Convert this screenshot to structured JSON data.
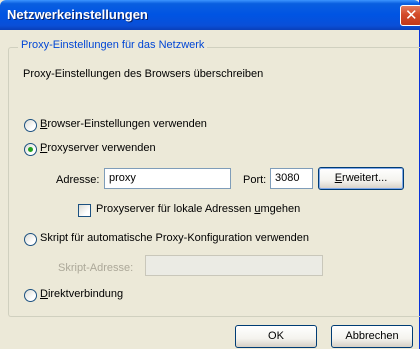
{
  "window": {
    "title": "Netzwerkeinstellungen"
  },
  "group": {
    "legend": "Proxy-Einstellungen für das Netzwerk",
    "override_label": "Proxy-Einstellungen des Browsers überschreiben"
  },
  "options": {
    "browser": {
      "label_rest": "rowser-Einstellungen verwenden",
      "mnemonic": "B",
      "selected": false
    },
    "proxy": {
      "label_rest": "roxyserver verwenden",
      "mnemonic": "P",
      "selected": true
    },
    "script": {
      "label": "Skript für automatische Proxy-Konfiguration verwenden",
      "selected": false
    },
    "direct": {
      "label_rest": "irektverbindung",
      "mnemonic": "D",
      "selected": false
    }
  },
  "proxy_fields": {
    "address_label": "Adresse:",
    "address_value": "proxy",
    "port_label": "Port:",
    "port_value": "3080",
    "advanced_mnemonic": "E",
    "advanced_rest": "rweitert...",
    "bypass_label_pre": "Proxyserver für lokale Adressen ",
    "bypass_mnemonic": "u",
    "bypass_label_post": "mgehen",
    "bypass_checked": false
  },
  "script_fields": {
    "address_label": "Skript-Adresse:",
    "address_value": ""
  },
  "buttons": {
    "ok": "OK",
    "cancel": "Abbrechen"
  },
  "colors": {
    "titlebar": "#0054e3",
    "dialog_bg": "#ece9d8",
    "legend_text": "#0046d5",
    "radio_selected": "#21a121"
  }
}
